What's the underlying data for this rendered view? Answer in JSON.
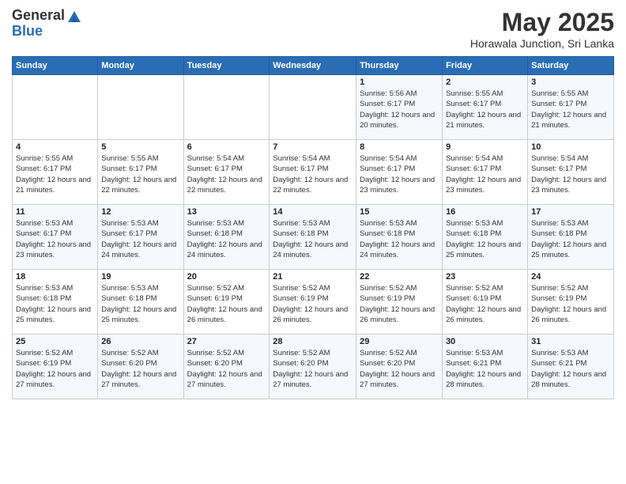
{
  "logo": {
    "general": "General",
    "blue": "Blue"
  },
  "title": "May 2025",
  "subtitle": "Horawala Junction, Sri Lanka",
  "days_header": [
    "Sunday",
    "Monday",
    "Tuesday",
    "Wednesday",
    "Thursday",
    "Friday",
    "Saturday"
  ],
  "weeks": [
    [
      {
        "day": "",
        "info": ""
      },
      {
        "day": "",
        "info": ""
      },
      {
        "day": "",
        "info": ""
      },
      {
        "day": "",
        "info": ""
      },
      {
        "day": "1",
        "info": "Sunrise: 5:56 AM\nSunset: 6:17 PM\nDaylight: 12 hours\nand 20 minutes."
      },
      {
        "day": "2",
        "info": "Sunrise: 5:55 AM\nSunset: 6:17 PM\nDaylight: 12 hours\nand 21 minutes."
      },
      {
        "day": "3",
        "info": "Sunrise: 5:55 AM\nSunset: 6:17 PM\nDaylight: 12 hours\nand 21 minutes."
      }
    ],
    [
      {
        "day": "4",
        "info": "Sunrise: 5:55 AM\nSunset: 6:17 PM\nDaylight: 12 hours\nand 21 minutes."
      },
      {
        "day": "5",
        "info": "Sunrise: 5:55 AM\nSunset: 6:17 PM\nDaylight: 12 hours\nand 22 minutes."
      },
      {
        "day": "6",
        "info": "Sunrise: 5:54 AM\nSunset: 6:17 PM\nDaylight: 12 hours\nand 22 minutes."
      },
      {
        "day": "7",
        "info": "Sunrise: 5:54 AM\nSunset: 6:17 PM\nDaylight: 12 hours\nand 22 minutes."
      },
      {
        "day": "8",
        "info": "Sunrise: 5:54 AM\nSunset: 6:17 PM\nDaylight: 12 hours\nand 23 minutes."
      },
      {
        "day": "9",
        "info": "Sunrise: 5:54 AM\nSunset: 6:17 PM\nDaylight: 12 hours\nand 23 minutes."
      },
      {
        "day": "10",
        "info": "Sunrise: 5:54 AM\nSunset: 6:17 PM\nDaylight: 12 hours\nand 23 minutes."
      }
    ],
    [
      {
        "day": "11",
        "info": "Sunrise: 5:53 AM\nSunset: 6:17 PM\nDaylight: 12 hours\nand 23 minutes."
      },
      {
        "day": "12",
        "info": "Sunrise: 5:53 AM\nSunset: 6:17 PM\nDaylight: 12 hours\nand 24 minutes."
      },
      {
        "day": "13",
        "info": "Sunrise: 5:53 AM\nSunset: 6:18 PM\nDaylight: 12 hours\nand 24 minutes."
      },
      {
        "day": "14",
        "info": "Sunrise: 5:53 AM\nSunset: 6:18 PM\nDaylight: 12 hours\nand 24 minutes."
      },
      {
        "day": "15",
        "info": "Sunrise: 5:53 AM\nSunset: 6:18 PM\nDaylight: 12 hours\nand 24 minutes."
      },
      {
        "day": "16",
        "info": "Sunrise: 5:53 AM\nSunset: 6:18 PM\nDaylight: 12 hours\nand 25 minutes."
      },
      {
        "day": "17",
        "info": "Sunrise: 5:53 AM\nSunset: 6:18 PM\nDaylight: 12 hours\nand 25 minutes."
      }
    ],
    [
      {
        "day": "18",
        "info": "Sunrise: 5:53 AM\nSunset: 6:18 PM\nDaylight: 12 hours\nand 25 minutes."
      },
      {
        "day": "19",
        "info": "Sunrise: 5:53 AM\nSunset: 6:18 PM\nDaylight: 12 hours\nand 25 minutes."
      },
      {
        "day": "20",
        "info": "Sunrise: 5:52 AM\nSunset: 6:19 PM\nDaylight: 12 hours\nand 26 minutes."
      },
      {
        "day": "21",
        "info": "Sunrise: 5:52 AM\nSunset: 6:19 PM\nDaylight: 12 hours\nand 26 minutes."
      },
      {
        "day": "22",
        "info": "Sunrise: 5:52 AM\nSunset: 6:19 PM\nDaylight: 12 hours\nand 26 minutes."
      },
      {
        "day": "23",
        "info": "Sunrise: 5:52 AM\nSunset: 6:19 PM\nDaylight: 12 hours\nand 26 minutes."
      },
      {
        "day": "24",
        "info": "Sunrise: 5:52 AM\nSunset: 6:19 PM\nDaylight: 12 hours\nand 26 minutes."
      }
    ],
    [
      {
        "day": "25",
        "info": "Sunrise: 5:52 AM\nSunset: 6:19 PM\nDaylight: 12 hours\nand 27 minutes."
      },
      {
        "day": "26",
        "info": "Sunrise: 5:52 AM\nSunset: 6:20 PM\nDaylight: 12 hours\nand 27 minutes."
      },
      {
        "day": "27",
        "info": "Sunrise: 5:52 AM\nSunset: 6:20 PM\nDaylight: 12 hours\nand 27 minutes."
      },
      {
        "day": "28",
        "info": "Sunrise: 5:52 AM\nSunset: 6:20 PM\nDaylight: 12 hours\nand 27 minutes."
      },
      {
        "day": "29",
        "info": "Sunrise: 5:52 AM\nSunset: 6:20 PM\nDaylight: 12 hours\nand 27 minutes."
      },
      {
        "day": "30",
        "info": "Sunrise: 5:53 AM\nSunset: 6:21 PM\nDaylight: 12 hours\nand 28 minutes."
      },
      {
        "day": "31",
        "info": "Sunrise: 5:53 AM\nSunset: 6:21 PM\nDaylight: 12 hours\nand 28 minutes."
      }
    ]
  ]
}
